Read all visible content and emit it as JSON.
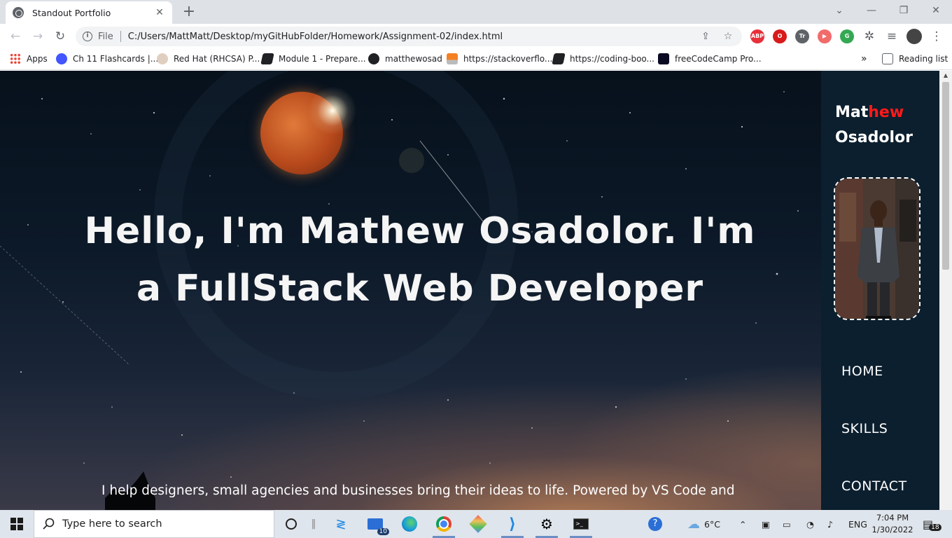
{
  "browser": {
    "tab_title": "Standout Portfolio",
    "url_scheme_label": "File",
    "url": "C:/Users/MattMatt/Desktop/myGitHubFolder/Homework/Assignment-02/index.html",
    "extensions": [
      {
        "label": "ABP",
        "color": "#e8303a"
      },
      {
        "label": "O",
        "color": "#d91a1a"
      },
      {
        "label": "Tr",
        "color": "#5f6368"
      },
      {
        "label": "▶",
        "color": "#f26b6b"
      },
      {
        "label": "G",
        "color": "#34a853"
      }
    ],
    "bookmarks": [
      {
        "label": "Apps",
        "icon": "apps-grid-icon"
      },
      {
        "label": "Ch 11 Flashcards |...",
        "icon": "quizlet-icon"
      },
      {
        "label": "Red Hat (RHCSA) P...",
        "icon": "udemy-icon"
      },
      {
        "label": "Module 1 - Prepare...",
        "icon": "page-icon"
      },
      {
        "label": "matthewosad",
        "icon": "github-icon"
      },
      {
        "label": "https://stackoverflo...",
        "icon": "stackoverflow-icon"
      },
      {
        "label": "https://coding-boo...",
        "icon": "page-icon"
      },
      {
        "label": "freeCodeCamp Pro...",
        "icon": "freecodecamp-icon"
      }
    ],
    "overflow_label": "»",
    "reading_list_label": "Reading list"
  },
  "page": {
    "hero_title": "Hello, I'm Mathew Osadolor. I'm a FullStack Web Developer",
    "hero_subtitle": "I help designers, small agencies and businesses bring their ideas to life. Powered by VS Code and",
    "brand_first_plain": "Mat",
    "brand_first_accent": "hew",
    "brand_last": "Osadolor",
    "nav": {
      "home": "HOME",
      "skills": "SKILLS",
      "contact": "CONTACT"
    },
    "colors": {
      "sidebar": "#0c1f2e",
      "accent": "#ff1a1a"
    }
  },
  "taskbar": {
    "search_placeholder": "Type here to search",
    "mail_badge": "10",
    "temperature": "6°C",
    "language": "ENG",
    "time": "7:04 PM",
    "date": "1/30/2022",
    "notification_count": "18"
  }
}
